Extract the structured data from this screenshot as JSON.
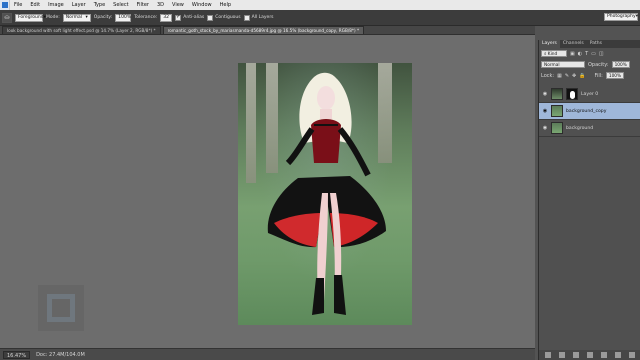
{
  "menubar": {
    "items": [
      "File",
      "Edit",
      "Image",
      "Layer",
      "Type",
      "Select",
      "Filter",
      "3D",
      "View",
      "Window",
      "Help"
    ]
  },
  "options": {
    "preset": "Foreground",
    "mode_label": "Mode:",
    "mode_value": "Normal",
    "opacity_label": "Opacity:",
    "opacity_value": "100%",
    "tolerance_label": "Tolerance:",
    "tolerance_value": "32",
    "anti_alias": "Anti-alias",
    "contiguous": "Contiguous",
    "all_layers": "All Layers",
    "workspace": "Photography"
  },
  "tabs": [
    {
      "label": "look background with soft light effect.psd @ 14.7% (Layer 2, RGB/8*) *"
    },
    {
      "label": "romantic_goth_stock_by_mariasmanda-d5689r4.jpg @ 16.5% (background_copy, RGB/8*) *"
    }
  ],
  "status": {
    "zoom": "16.47%",
    "doc": "Doc: 27.4M/104.0M"
  },
  "panel": {
    "tabs": [
      "Layers",
      "Channels",
      "Paths"
    ],
    "kind": "Kind",
    "blend": "Normal",
    "opacity_label": "Opacity:",
    "opacity_value": "100%",
    "lock_label": "Lock:",
    "fill_label": "Fill:",
    "fill_value": "100%",
    "layers": [
      {
        "name": "Layer 0"
      },
      {
        "name": "background_copy"
      },
      {
        "name": "background"
      }
    ]
  }
}
